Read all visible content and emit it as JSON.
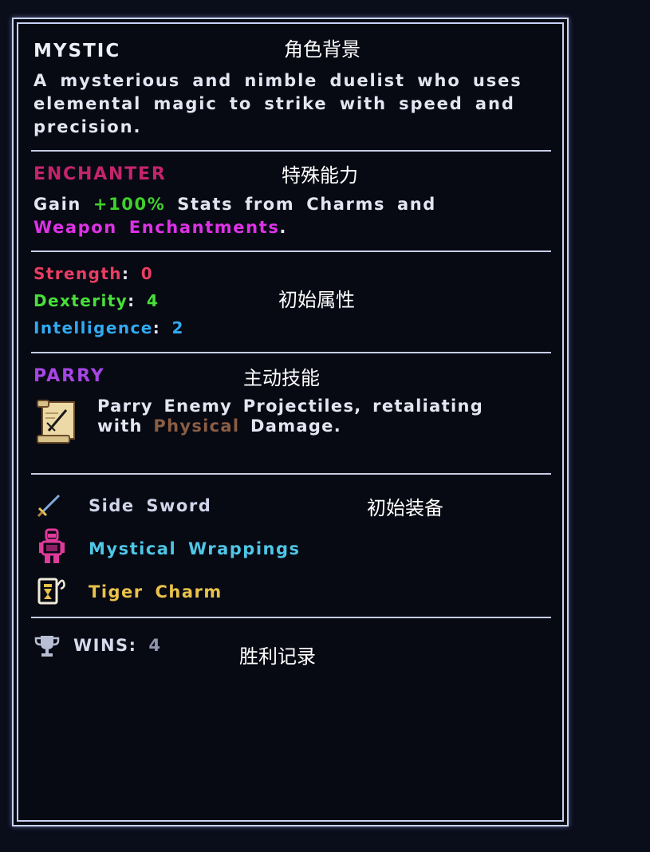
{
  "annotations": {
    "background": "角色背景",
    "special_ability": "特殊能力",
    "starting_attributes": "初始属性",
    "active_skill": "主动技能",
    "starting_equipment": "初始装备",
    "win_record": "胜利记录"
  },
  "character": {
    "name": "MYSTIC",
    "description_line1": "A mysterious and nimble duelist who uses",
    "description_line2": "elemental magic to strike with speed and",
    "description_line3": "precision."
  },
  "passive": {
    "name": "ENCHANTER",
    "pre": "Gain",
    "bonus": "+100%",
    "mid": "Stats from Charms and",
    "highlight": "Weapon Enchantments",
    "end": "."
  },
  "stats": {
    "strength_label": "Strength",
    "strength_value": "0",
    "dexterity_label": "Dexterity",
    "dexterity_value": "4",
    "intelligence_label": "Intelligence",
    "intelligence_value": "2",
    "separator": ":"
  },
  "skill": {
    "name": "PARRY",
    "line1": "Parry Enemy Projectiles, retaliating",
    "line2_pre": "with",
    "damage_type": "Physical",
    "line2_post": "Damage."
  },
  "equipment": [
    {
      "name": "Side Sword",
      "icon": "sword-icon",
      "color": "#d0d5ea"
    },
    {
      "name": "Mystical Wrappings",
      "icon": "armor-icon",
      "color": "#4fc6e6"
    },
    {
      "name": "Tiger Charm",
      "icon": "charm-icon",
      "color": "#e8c24a"
    }
  ],
  "wins": {
    "label": "WINS:",
    "value": "4",
    "icon": "trophy-icon"
  },
  "colors": {
    "name": "#eceff8",
    "body": "#e3e6f2",
    "passive_name": "#c4246c",
    "bonus": "#3fd12c",
    "enchant": "#dd32e6",
    "strength": "#ea3d63",
    "dexterity": "#47e039",
    "intelligence": "#31aaf0",
    "skill_name": "#a745e6",
    "physical": "#8b5d43",
    "border": "#c9d2f5"
  }
}
